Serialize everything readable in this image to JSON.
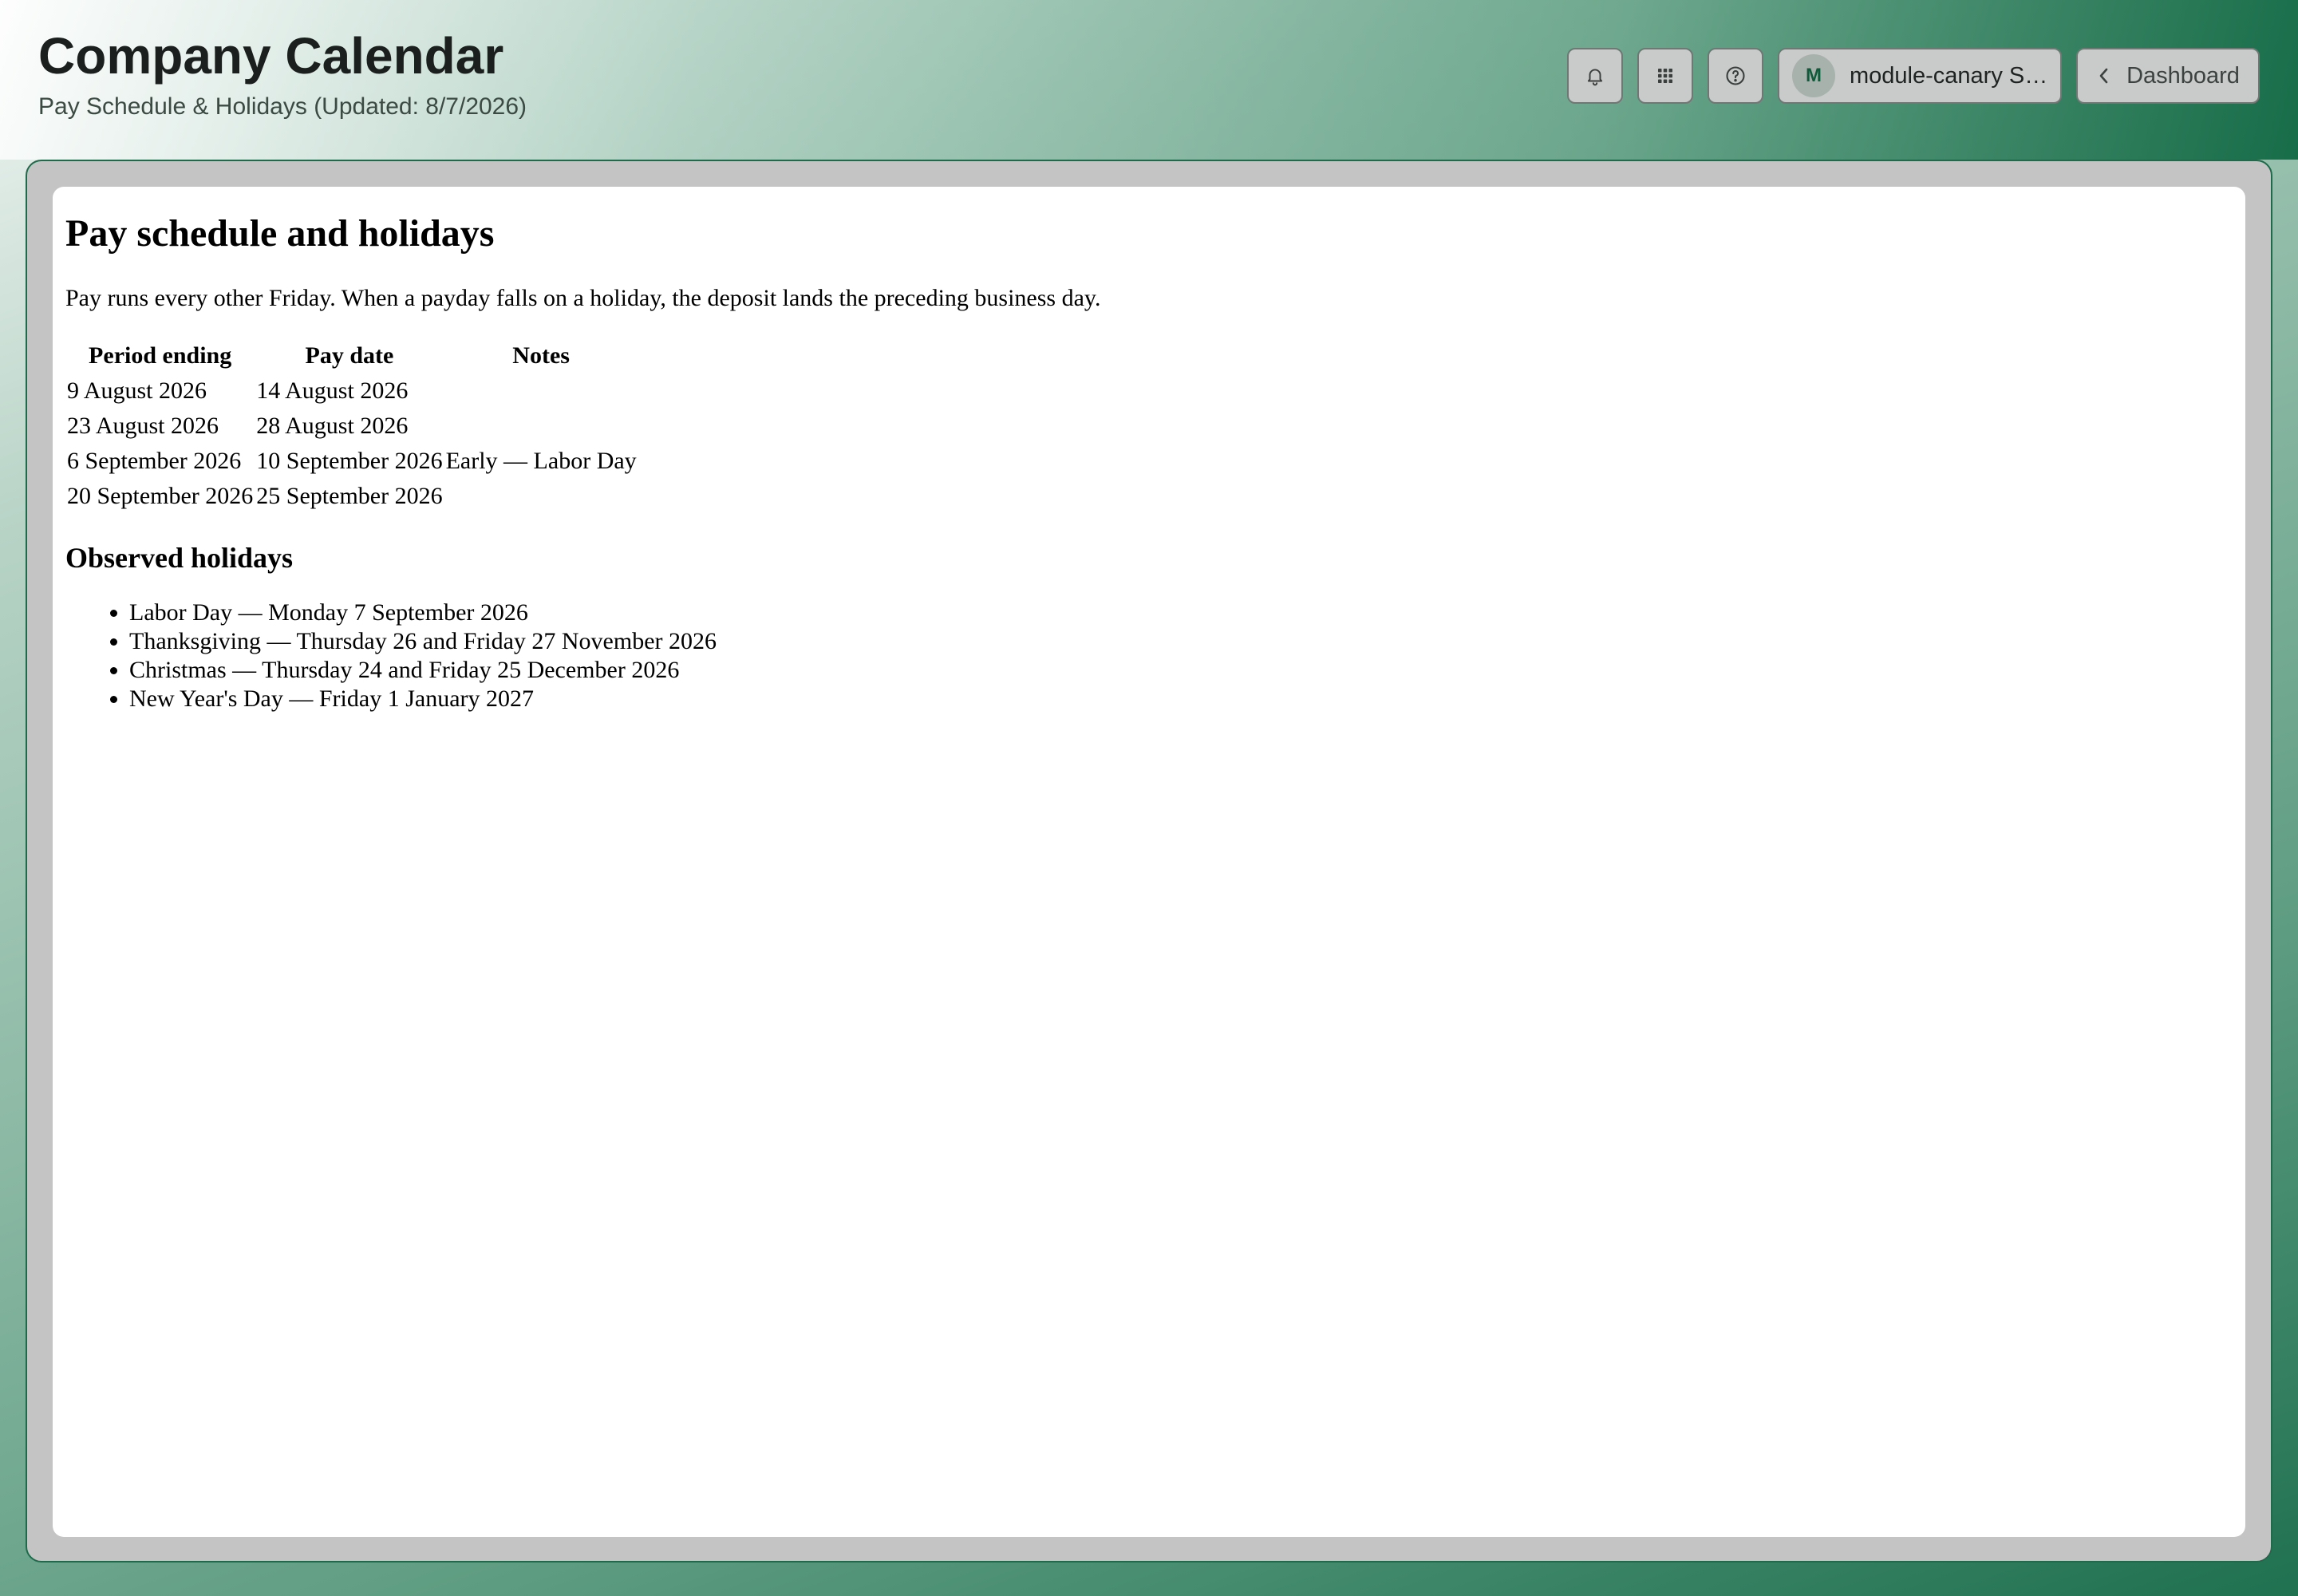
{
  "header": {
    "title": "Company Calendar",
    "subtitle": "Pay Schedule & Holidays (Updated: 8/7/2026)",
    "icons": [
      "bell-icon",
      "apps-grid-icon",
      "help-icon"
    ],
    "user": {
      "initial": "M",
      "name": "module-canary S…"
    },
    "dashboard_label": "Dashboard"
  },
  "colors": {
    "accent": "#0f6b45",
    "avatar_bg": "#a8b2ad",
    "frame_bg": "#c4c4c4"
  },
  "page": {
    "heading": "Pay schedule and holidays",
    "intro": "Pay runs every other Friday. When a payday falls on a holiday, the deposit lands the preceding business day.",
    "table": {
      "headers": [
        "Period ending",
        "Pay date",
        "Notes"
      ],
      "rows": [
        [
          "9 August 2026",
          "14 August 2026",
          ""
        ],
        [
          "23 August 2026",
          "28 August 2026",
          ""
        ],
        [
          "6 September 2026",
          "10 September 2026",
          "Early — Labor Day"
        ],
        [
          "20 September 2026",
          "25 September 2026",
          ""
        ]
      ]
    },
    "holidays_heading": "Observed holidays",
    "holidays": [
      "Labor Day — Monday 7 September 2026",
      "Thanksgiving — Thursday 26 and Friday 27 November 2026",
      "Christmas — Thursday 24 and Friday 25 December 2026",
      "New Year's Day — Friday 1 January 2027"
    ]
  }
}
